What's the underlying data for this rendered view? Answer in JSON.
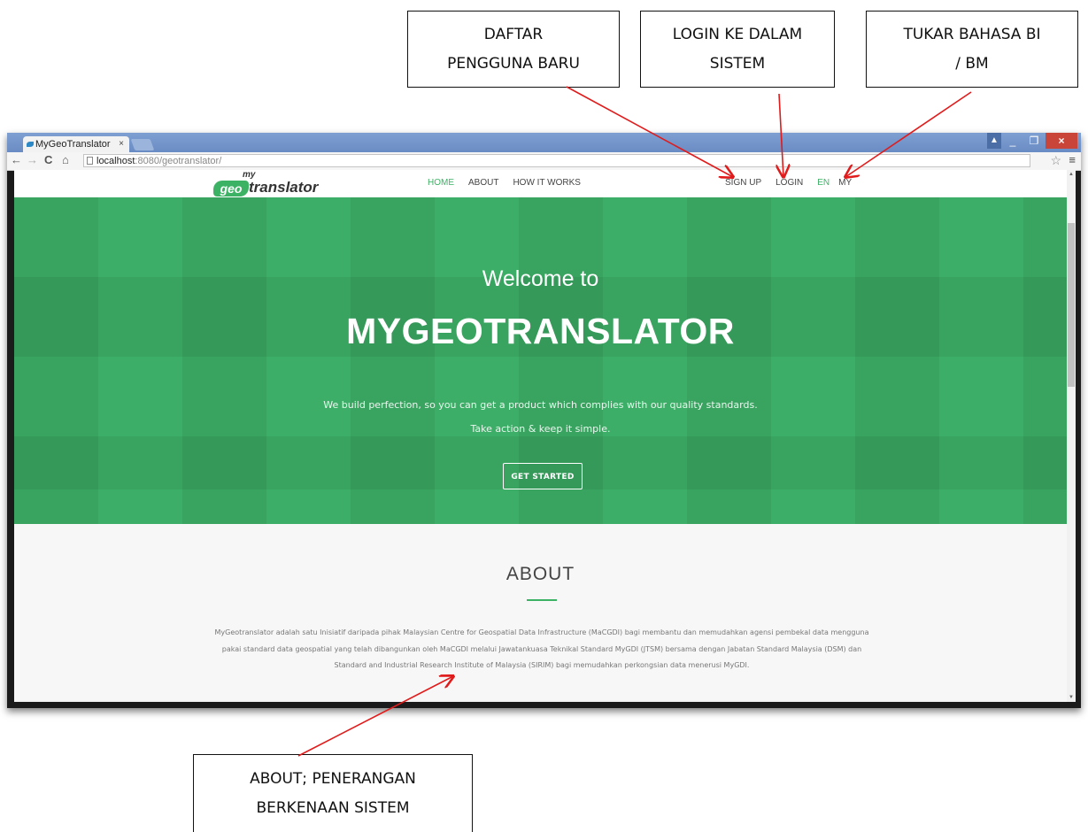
{
  "callouts": {
    "signup": [
      "DAFTAR",
      "PENGGUNA BARU"
    ],
    "login": [
      "LOGIN KE DALAM",
      "SISTEM"
    ],
    "lang": [
      "TUKAR BAHASA BI",
      "/ BM"
    ],
    "about": [
      "ABOUT; PENERANGAN",
      "BERKENAAN SISTEM"
    ]
  },
  "browser": {
    "tab_title": "MyGeoTranslator",
    "tab_close": "×",
    "url_host": "localhost",
    "url_path": ":8080/geotranslator/",
    "back_icon": "←",
    "forward_icon": "→",
    "reload_icon": "C",
    "home_icon": "⌂",
    "star_icon": "☆",
    "menu_icon": "≡",
    "minimize": "_",
    "maximize": "❐",
    "close": "×",
    "user": "▲"
  },
  "site": {
    "logo_my": "my",
    "logo_geo": "geo",
    "logo_rest": "translator",
    "nav": {
      "home": "HOME",
      "about": "ABOUT",
      "how": "HOW IT WORKS",
      "signup": "SIGN UP",
      "login": "LOGIN",
      "en": "EN",
      "my": "MY"
    },
    "hero": {
      "welcome": "Welcome to",
      "title": "MYGEOTRANSLATOR",
      "line1": "We build perfection, so you can get a product which complies with our quality standards.",
      "line2": "Take action & keep it simple.",
      "button": "GET STARTED"
    },
    "about": {
      "title": "ABOUT",
      "text": "MyGeotranslator adalah satu Inisiatif daripada pihak Malaysian Centre for Geospatial Data Infrastructure (MaCGDI) bagi membantu dan memudahkan agensi pembekal data mengguna pakai standard data geospatial yang telah dibangunkan oleh MaCGDI melalui Jawatankuasa Teknikal Standard MyGDI (JTSM) bersama dengan Jabatan Standard Malaysia (DSM) dan Standard and Industrial Research Institute of Malaysia (SIRIM) bagi memudahkan perkongsian data menerusi MyGDI."
    }
  },
  "colors": {
    "accent": "#3cb264",
    "hero": "#3dae67",
    "arrow": "#e01b1b"
  }
}
